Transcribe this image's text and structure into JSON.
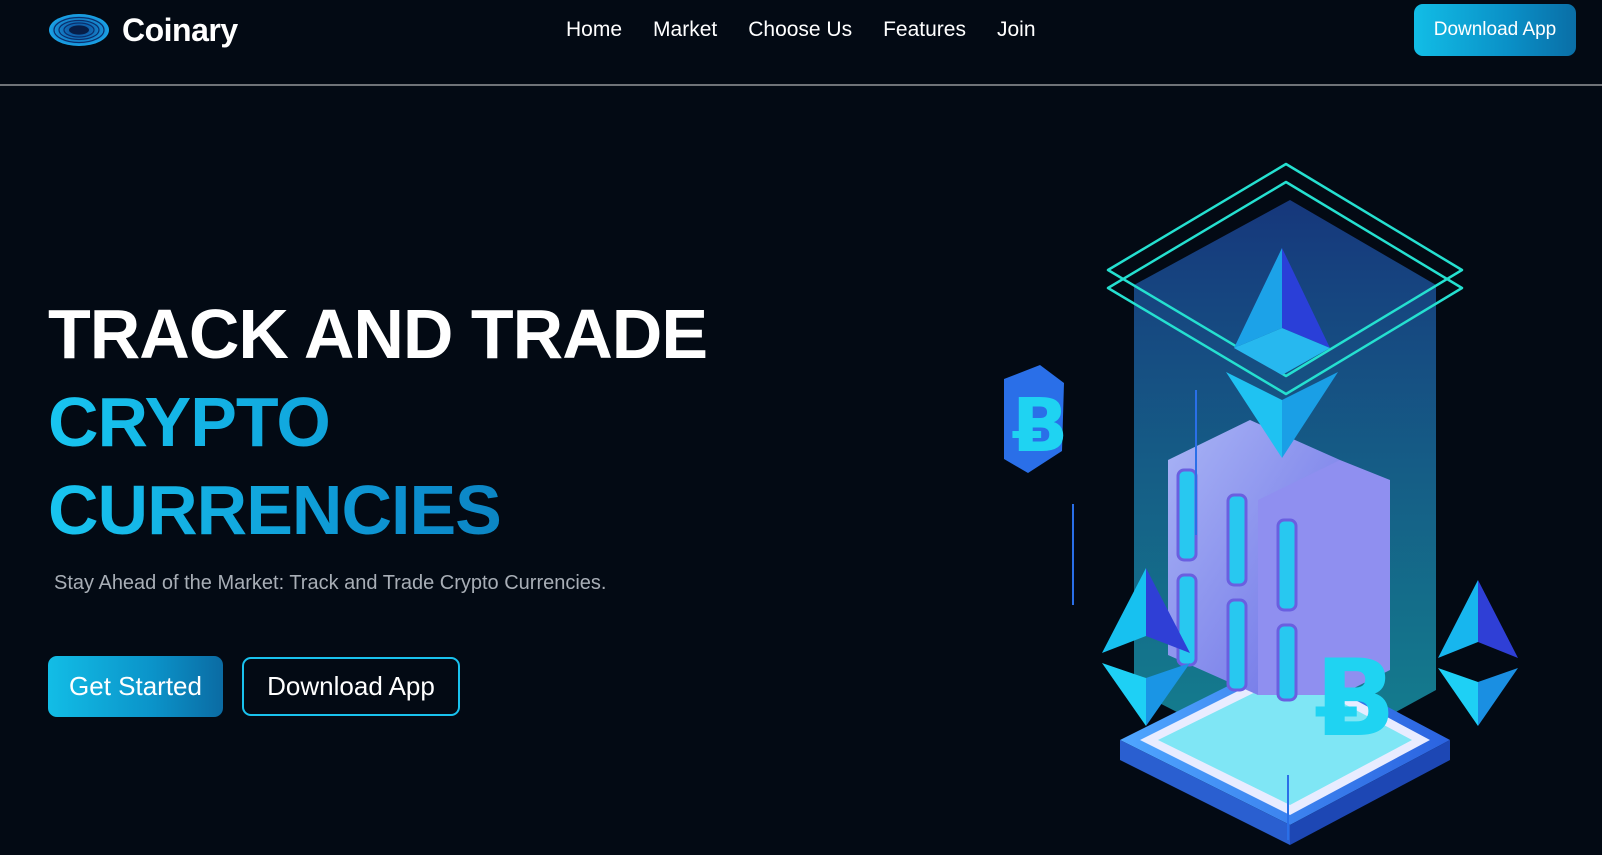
{
  "brand": {
    "name": "Coinary",
    "logo_icon": "eye-ring-logo-icon",
    "accent": "#12bde6",
    "accent_dark": "#0a6ea6",
    "background": "#030a14"
  },
  "nav": {
    "items": [
      {
        "label": "Home"
      },
      {
        "label": "Market"
      },
      {
        "label": "Choose Us"
      },
      {
        "label": "Features"
      },
      {
        "label": "Join"
      }
    ],
    "cta_label": "Download App"
  },
  "hero": {
    "title_line1": "TRACK AND TRADE",
    "title_line2": "CRYPTO",
    "title_line3": "CURRENCIES",
    "subtitle": "Stay Ahead of the Market: Track and Trade Crypto Currencies.",
    "primary_button": "Get Started",
    "secondary_button": "Download App"
  },
  "illustration": {
    "icons": [
      "bitcoin-icon",
      "ethereum-icon",
      "server-rack-icon",
      "hologram-platform-icon"
    ]
  }
}
